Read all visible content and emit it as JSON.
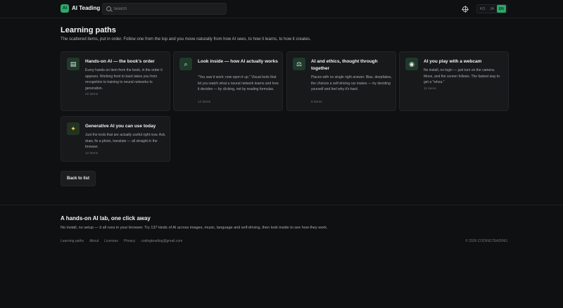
{
  "header": {
    "logo_mark": "AI",
    "app_name": "AI Teading",
    "search_placeholder": "Search",
    "languages": [
      "KO",
      "JA",
      "EN"
    ],
    "active_language": "EN"
  },
  "main": {
    "title": "Learning paths",
    "subtitle": "The scattered items, put in order. Follow one from the top and you move naturally from how AI sees, to how it learns, to how it creates.",
    "cards": [
      {
        "icon": "book-icon",
        "glyph": "▤",
        "title": "Hands-on AI — the book's order",
        "description": "Every hands-on item from the book, in the order it appears. Working front to back takes you from recognition to training to neural networks to generation.",
        "count": "22 items"
      },
      {
        "icon": "microscope-icon",
        "glyph": "⌕",
        "title": "Look inside — how AI actually works",
        "description": "\"You saw it work; now open it up.\" Visual tools that let you watch what a neural network learns and how it decides — by clicking, not by reading formulas.",
        "count": "14 items"
      },
      {
        "icon": "scales-icon",
        "glyph": "⚖",
        "title": "AI and ethics, thought through together",
        "description": "Places with no single right answer. Bias, deepfakes, the choices a self-driving car makes — try deciding yourself and feel why it's hard.",
        "count": "8 items"
      },
      {
        "icon": "webcam-icon",
        "glyph": "◉",
        "title": "AI you play with a webcam",
        "description": "No install, no login — just turn on the camera. Move, and the screen follows. The fastest way to get a \"whoa.\"",
        "count": "11 items"
      },
      {
        "icon": "sparkle-icon",
        "glyph": "✦",
        "title": "Generative AI you can use today",
        "description": "Just the tools that are actually useful right now. Ask, draw, fix a photo, translate — all straight in the browser.",
        "count": "12 items"
      }
    ],
    "back_label": "Back to list"
  },
  "footer": {
    "title": "A hands-on AI lab, one click away",
    "description": "No install, no setup — it all runs in your browser. Try 137 kinds of AI across images, music, language and self-driving, then look inside to see how they work.",
    "links": [
      "Learning paths",
      "About",
      "Licenses",
      "Privacy",
      "codingteading@gmail.com"
    ],
    "copyright": "© 2026 CODINGTEADING"
  },
  "colors": {
    "accent": "#2ea86a",
    "background": "#0f1011",
    "card": "#17191b"
  }
}
